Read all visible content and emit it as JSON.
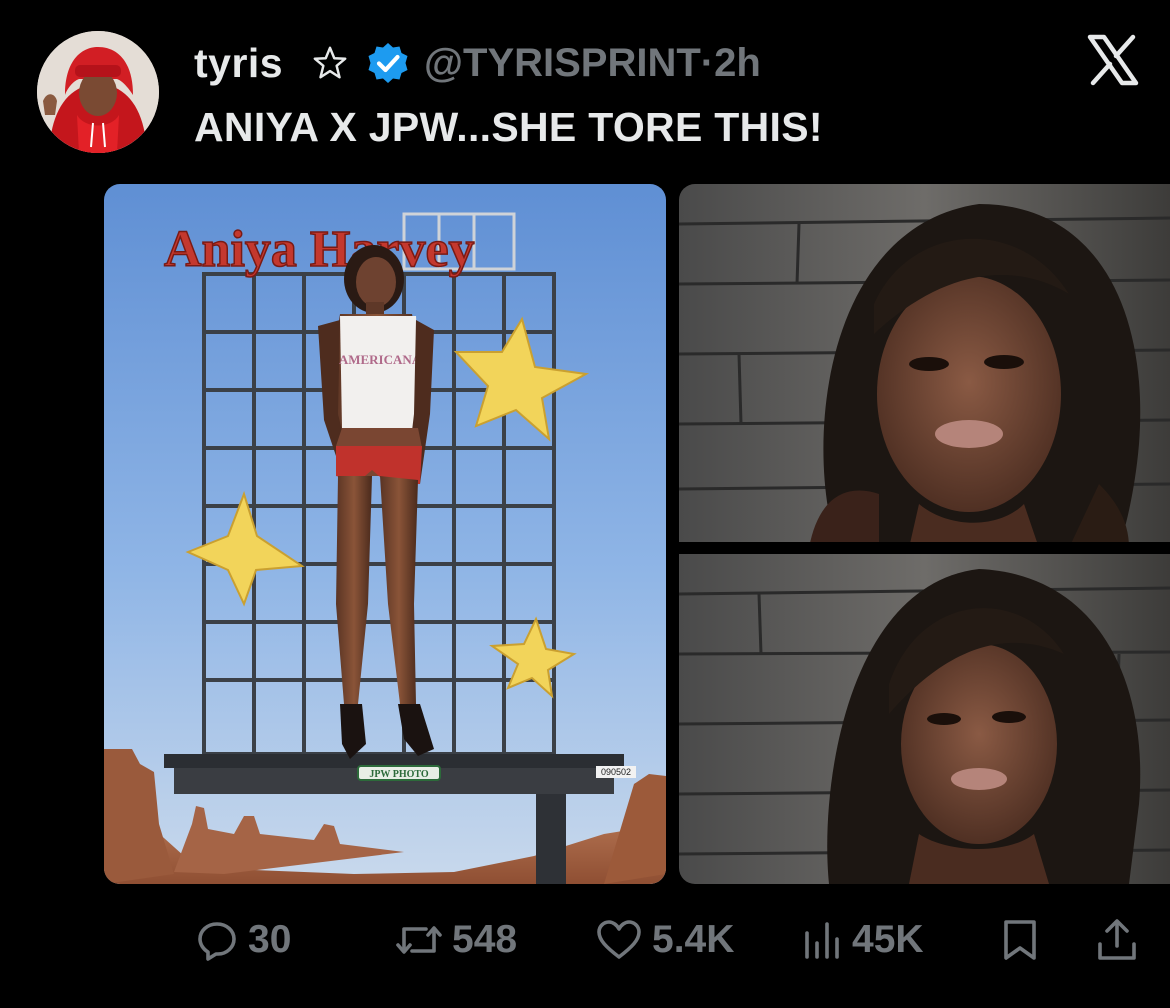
{
  "post": {
    "author_name": "tyris",
    "handle_time": "@TYRISPRINT·2h",
    "text": "ANIYA X JPW...SHE TORE THIS!",
    "verified_color": "#1d9bf0"
  },
  "media_left": {
    "billboard_title": "Aniya Harvey",
    "shirt_text": "AMERICANA",
    "logo_text": "JPW PHOTO",
    "code_text": "090502"
  },
  "actions": {
    "replies": "30",
    "reposts": "548",
    "likes": "5.4K",
    "views": "45K"
  },
  "icons": [
    "x-logo-icon",
    "star-outline-icon",
    "verified-badge-icon",
    "reply-icon",
    "repost-icon",
    "like-icon",
    "views-icon",
    "bookmark-icon",
    "share-icon"
  ]
}
